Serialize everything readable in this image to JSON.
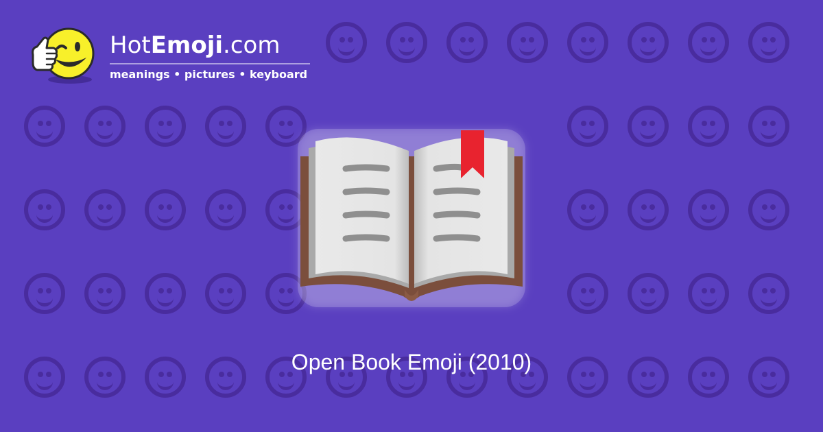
{
  "logo": {
    "brand_hot": "Hot",
    "brand_emoji": "Emoji",
    "brand_domain": ".com",
    "tagline": "meanings • pictures • keyboard",
    "mascot_icon": "thumbs-up-wink-face-icon"
  },
  "emoji": {
    "icon": "open-book-icon",
    "title": "Open Book Emoji (2010)"
  },
  "colors": {
    "background": "#5a3fc0",
    "pattern": "#3c1e82",
    "bookmark": "#e8232f",
    "mascot_face": "#f8f02a"
  }
}
